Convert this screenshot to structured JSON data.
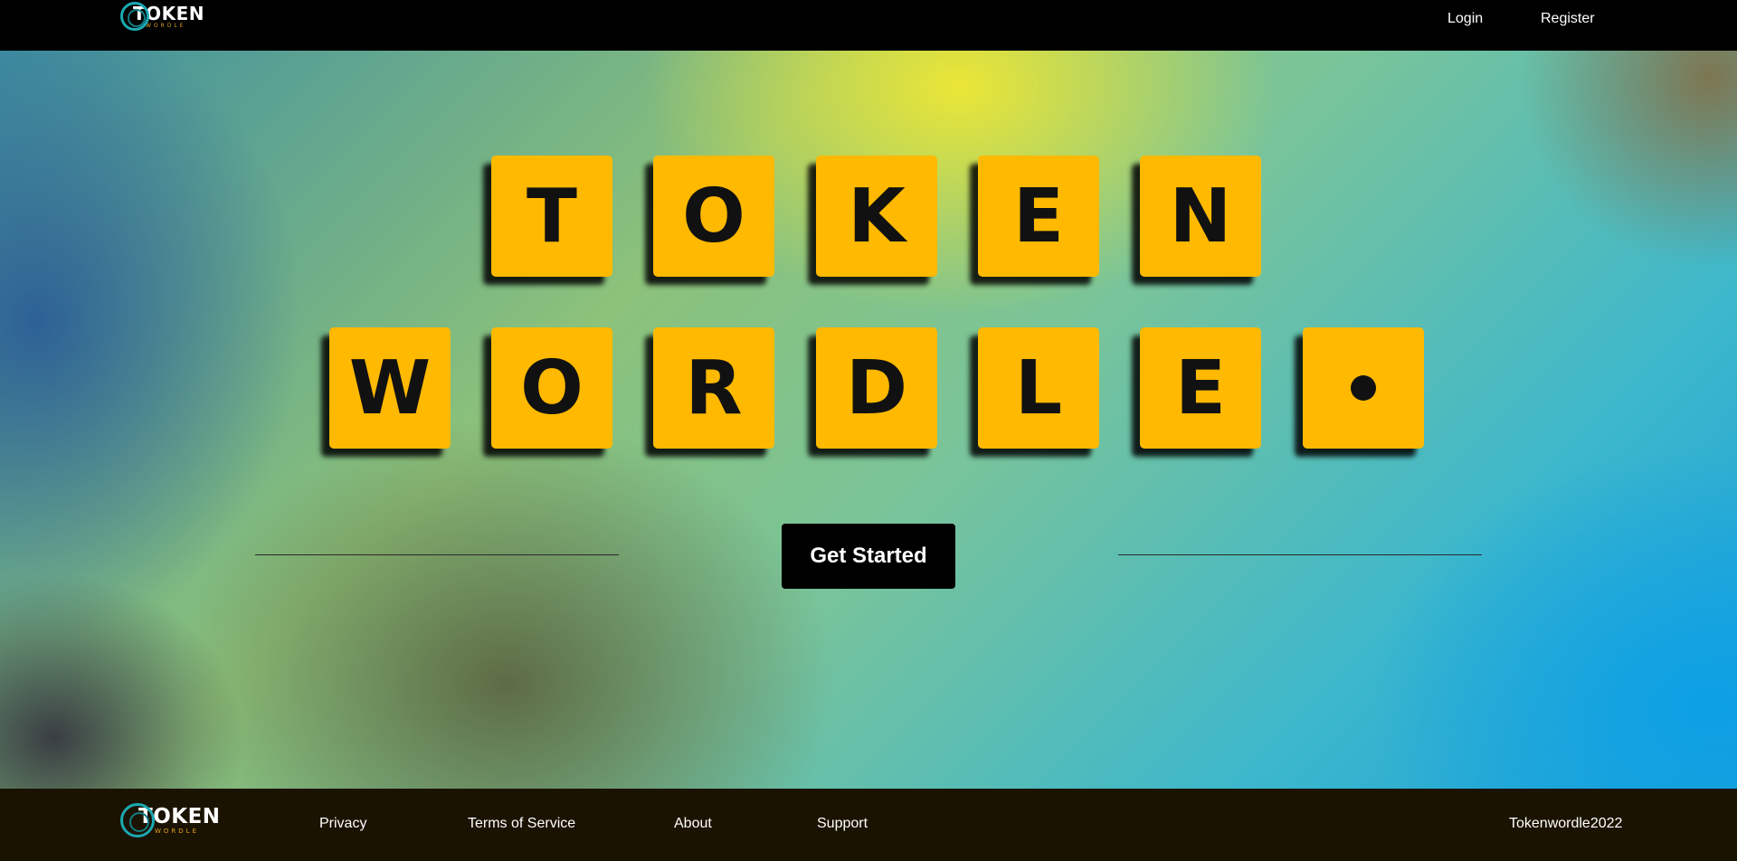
{
  "header": {
    "logo": {
      "word": "TOKEN",
      "subword": "WORDLE"
    },
    "nav": {
      "login": "Login",
      "register": "Register"
    }
  },
  "hero": {
    "row1": [
      "T",
      "O",
      "K",
      "E",
      "N"
    ],
    "row2": [
      "W",
      "O",
      "R",
      "D",
      "L",
      "E",
      "•"
    ],
    "cta_label": "Get Started"
  },
  "footer": {
    "logo": {
      "word": "TOKEN",
      "subword": "WORDLE"
    },
    "links": {
      "privacy": "Privacy",
      "terms": "Terms of Service",
      "about": "About",
      "support": "Support"
    },
    "copyright": "Tokenwordle2022"
  },
  "colors": {
    "tile": "#ffb900",
    "header_bg": "#000000",
    "footer_bg": "#1b1302",
    "button_bg": "#000000"
  }
}
